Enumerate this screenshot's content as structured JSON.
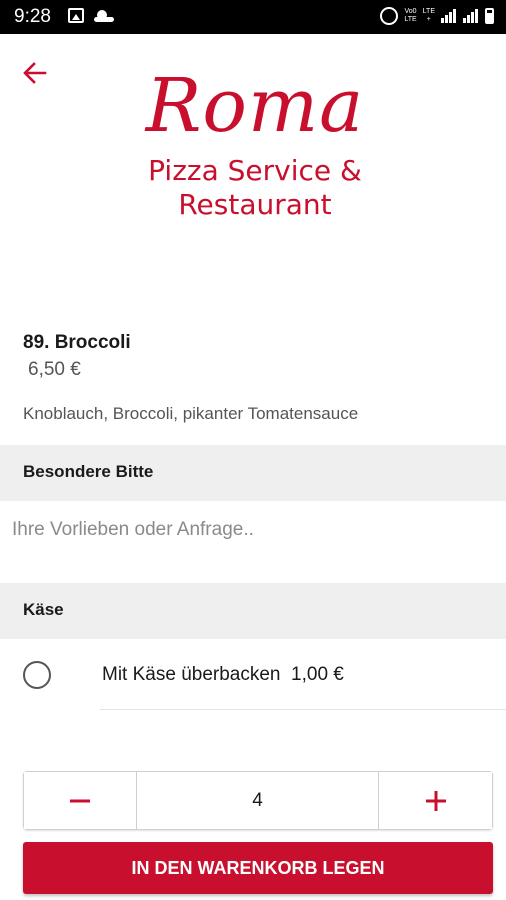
{
  "status_bar": {
    "time": "9:28",
    "network_1": "Vo0\nLTE",
    "network_2": "LTE\n+"
  },
  "header": {
    "back_icon": "arrow-left-icon",
    "logo_main": "Roma",
    "logo_line1": "Pizza Service &",
    "logo_line2": "Restaurant"
  },
  "product": {
    "name": "89. Broccoli",
    "price": "6,50 €",
    "description": "Knoblauch, Broccoli, pikanter Tomatensauce"
  },
  "special_request": {
    "title": "Besondere Bitte",
    "placeholder": "Ihre Vorlieben oder Anfrage..",
    "value": ""
  },
  "cheese": {
    "title": "Käse",
    "option_label": "Mit Käse überbacken  1,00 €",
    "selected": false
  },
  "quantity": {
    "value": "4",
    "minus_icon": "minus-icon",
    "plus_icon": "plus-icon"
  },
  "cart_button": {
    "label": "IN DEN WARENKORB LEGEN"
  },
  "colors": {
    "accent": "#c8102e",
    "section_bg": "#efefef"
  }
}
